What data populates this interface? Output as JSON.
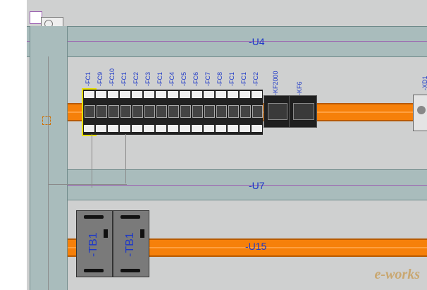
{
  "duct_labels": {
    "u4": "-U4",
    "u7": "-U7",
    "u15": "-U15"
  },
  "breakers": [
    {
      "label": "-FC1"
    },
    {
      "label": "-FC9"
    },
    {
      "label": "-FC10"
    },
    {
      "label": "-FC1"
    },
    {
      "label": "-FC2"
    },
    {
      "label": "-FC3"
    },
    {
      "label": "-FC1"
    },
    {
      "label": "-FC4"
    },
    {
      "label": "-FC5"
    },
    {
      "label": "-FC6"
    },
    {
      "label": "-FC7"
    },
    {
      "label": "-FC8"
    },
    {
      "label": "-FC1"
    },
    {
      "label": "-FC1"
    },
    {
      "label": "-FC2"
    }
  ],
  "relays": {
    "kf2000": "-KF2000",
    "kf6": "-KF6",
    "xd1": "-XD1"
  },
  "power_supplies": [
    {
      "label": "-TB1"
    },
    {
      "label": "-TB1"
    }
  ],
  "watermark": "e-works",
  "colors": {
    "rail": "#f6800a",
    "duct": "#a9bcbc",
    "label": "#1d38c8",
    "selection": "#e8e000"
  }
}
